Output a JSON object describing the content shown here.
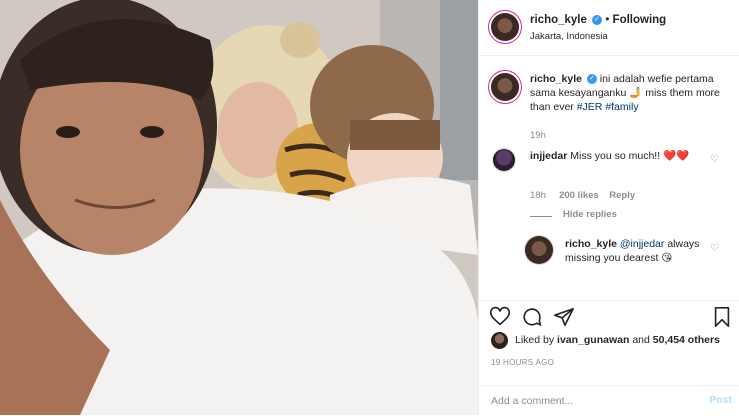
{
  "post": {
    "author": "richo_kyle",
    "follow_status": "Following",
    "location": "Jakarta, Indonesia"
  },
  "caption": {
    "username": "richo_kyle",
    "text": "ini adalah wefie pertama sama kesayanganku 🤳 miss them more than ever",
    "hashtags": [
      "#JER",
      "#family"
    ],
    "age": "19h"
  },
  "comments": [
    {
      "username": "injjedar",
      "text": "Miss you so much!!",
      "emoji": "❤️❤️",
      "age": "18h",
      "likes": "200 likes",
      "reply_label": "Reply",
      "hide_replies_label": "Hide replies"
    },
    {
      "username": "richo_kyle",
      "mention": "@injjedar",
      "text": "always missing you dearest",
      "emoji": "😘"
    }
  ],
  "actions": {
    "like_icon": "heart-icon",
    "comment_icon": "comment-icon",
    "share_icon": "share-icon",
    "save_icon": "bookmark-icon"
  },
  "likes": {
    "prefix": "Liked by",
    "user": "ivan_gunawan",
    "mid": "and",
    "count": "50,454 others"
  },
  "timestamp": "19 HOURS AGO",
  "add_comment": {
    "placeholder": "Add a comment...",
    "post_label": "Post"
  },
  "colors": {
    "accent": "#3897f0",
    "link": "#003569",
    "muted": "#8e8e8e",
    "heart_red": "#ed4956",
    "border": "#efefef"
  }
}
